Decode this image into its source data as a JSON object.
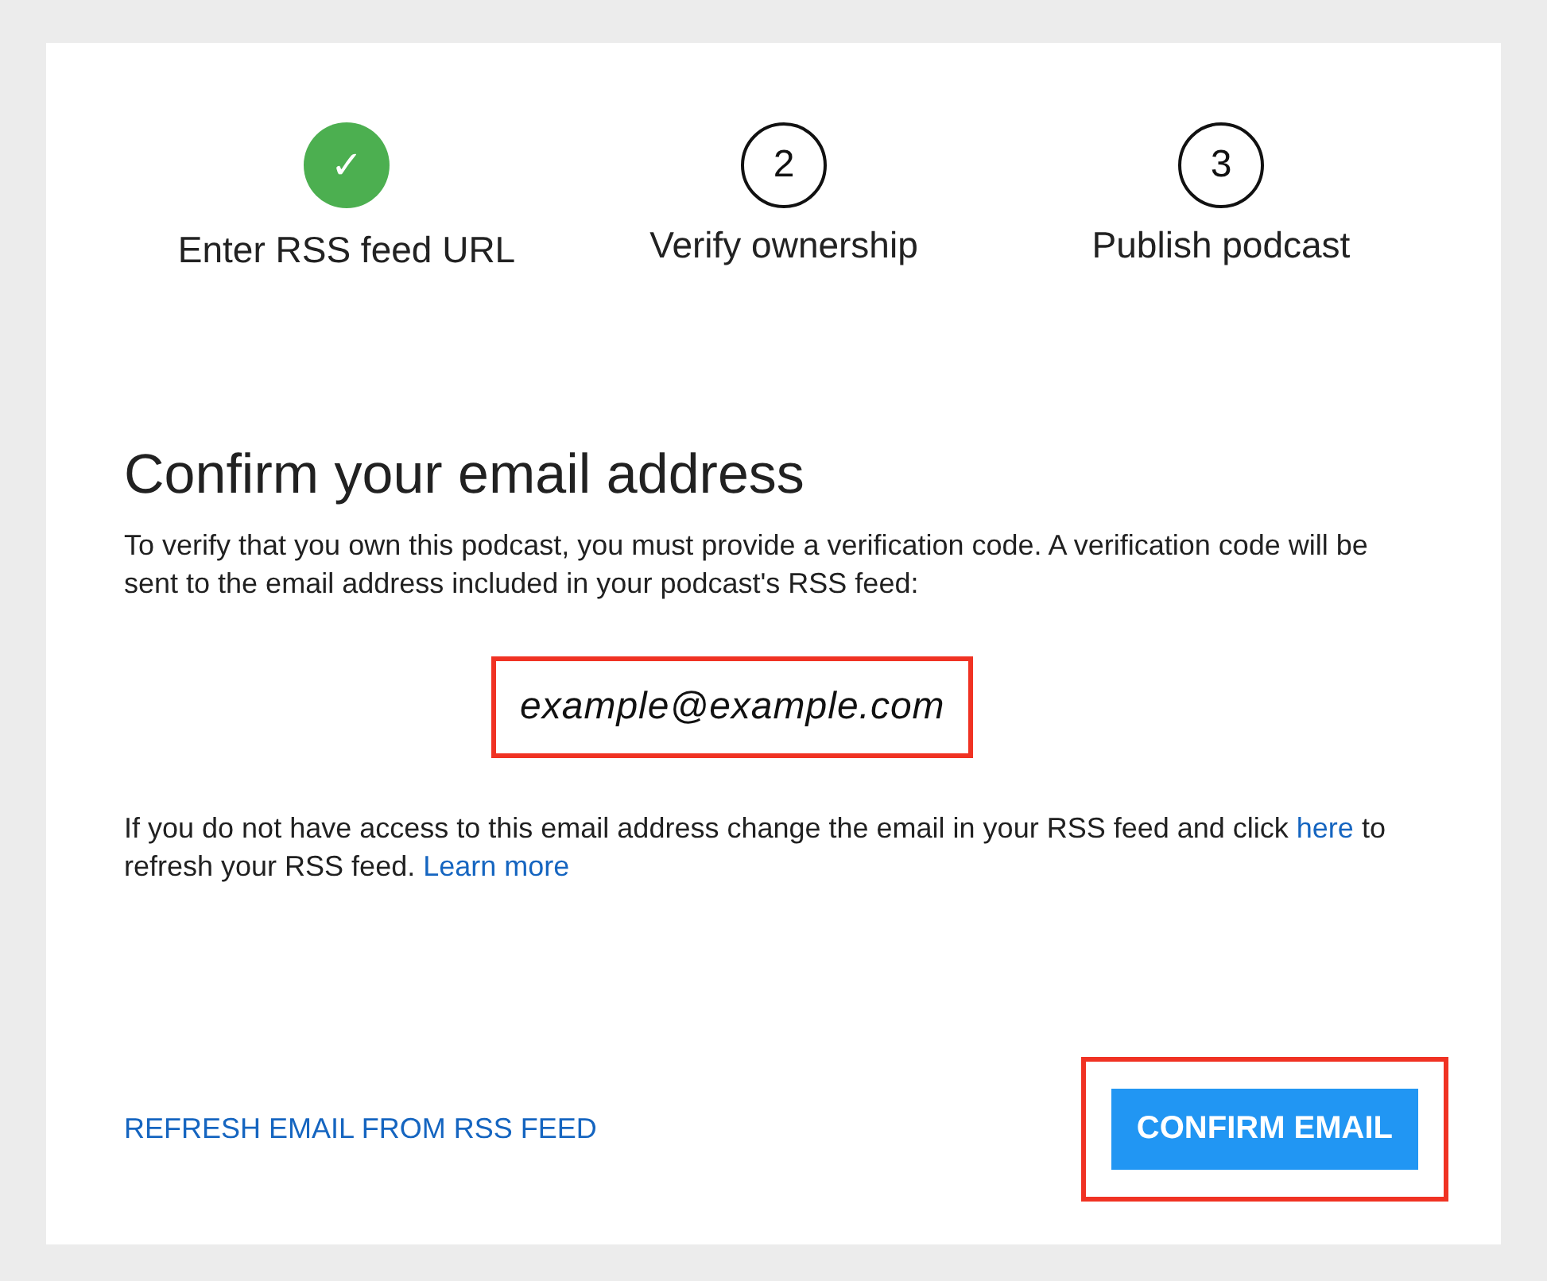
{
  "steps": [
    {
      "number": "✓",
      "label": "Enter RSS feed URL",
      "completed": true
    },
    {
      "number": "2",
      "label": "Verify ownership",
      "completed": false
    },
    {
      "number": "3",
      "label": "Publish podcast",
      "completed": false
    }
  ],
  "heading": "Confirm your email address",
  "intro": "To verify that you own this podcast, you must provide a verification code. A verification code will be sent to the email address included in your podcast's RSS feed:",
  "email": {
    "text": "example@example.com",
    "highlighted": true
  },
  "note": [
    {
      "kind": "text",
      "text": "If you do not have access to this email address change the email in your RSS feed and click "
    },
    {
      "kind": "link",
      "text": "here"
    },
    {
      "kind": "text",
      "text": " to refresh your RSS feed. "
    },
    {
      "kind": "link",
      "text": "Learn more"
    }
  ],
  "refresh_link": "REFRESH EMAIL FROM RSS FEED",
  "confirm_button": {
    "label": "CONFIRM EMAIL",
    "highlighted": true
  }
}
